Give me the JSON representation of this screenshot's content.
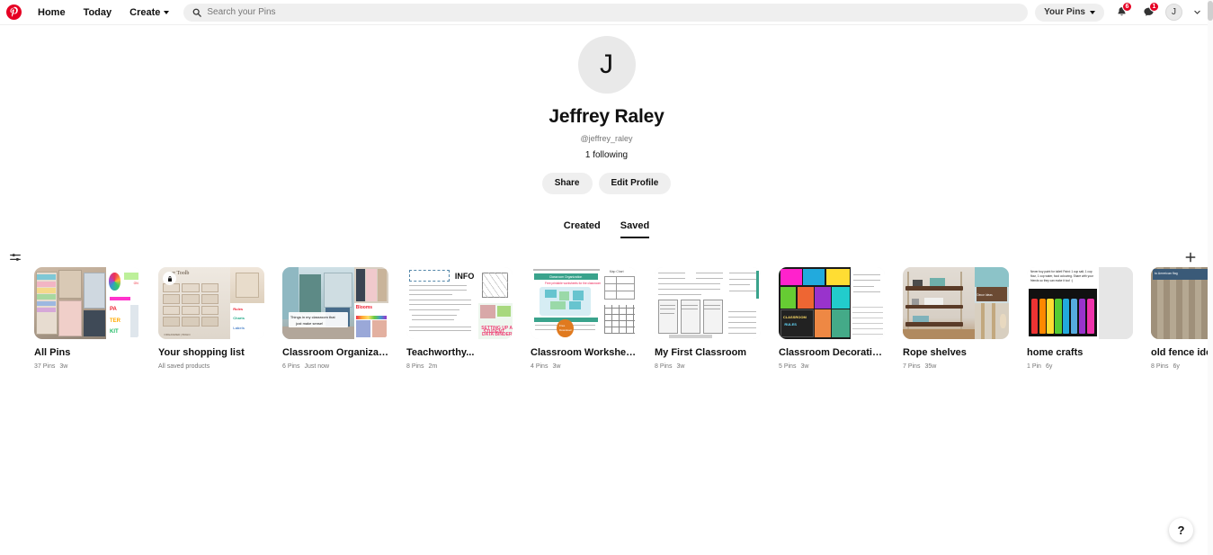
{
  "header": {
    "logo": "pinterest-logo",
    "nav": [
      {
        "label": "Home",
        "name": "nav-home"
      },
      {
        "label": "Today",
        "name": "nav-today"
      },
      {
        "label": "Create",
        "name": "nav-create"
      }
    ],
    "search": {
      "placeholder": "Search your Pins",
      "value": "",
      "icon": "search-icon"
    },
    "your_pins_label": "Your Pins",
    "notifications_badge": "6",
    "messages_badge": "1",
    "avatar_initial": "J"
  },
  "profile": {
    "avatar_initial": "J",
    "name": "Jeffrey Raley",
    "handle": "@jeffrey_raley",
    "following": "1 following",
    "share_label": "Share",
    "edit_label": "Edit Profile"
  },
  "tabs": [
    {
      "label": "Created",
      "active": false
    },
    {
      "label": "Saved",
      "active": true
    }
  ],
  "toolbar": {
    "filter_icon": "sliders-icon",
    "add_icon": "plus-icon"
  },
  "boards": [
    {
      "title": "All Pins",
      "pins": "37 Pins",
      "updated": "3w",
      "secret": false
    },
    {
      "title": "Your shopping list",
      "pins": "All saved products",
      "updated": "",
      "secret": true
    },
    {
      "title": "Classroom Organization",
      "pins": "6 Pins",
      "updated": "Just now",
      "secret": false
    },
    {
      "title": "Teachworthy...",
      "pins": "8 Pins",
      "updated": "2m",
      "secret": false
    },
    {
      "title": "Classroom Worksheets",
      "pins": "4 Pins",
      "updated": "3w",
      "secret": false
    },
    {
      "title": "My First Classroom",
      "pins": "8 Pins",
      "updated": "3w",
      "secret": false
    },
    {
      "title": "Classroom Decoration...",
      "pins": "5 Pins",
      "updated": "3w",
      "secret": false
    },
    {
      "title": "Rope shelves",
      "pins": "7 Pins",
      "updated": "35w",
      "secret": false
    },
    {
      "title": "home crafts",
      "pins": "1 Pin",
      "updated": "6y",
      "secret": false
    },
    {
      "title": "old fence ideas",
      "pins": "8 Pins",
      "updated": "6y",
      "secret": false
    }
  ],
  "help": {
    "label": "?"
  },
  "colors": {
    "brand": "#e60023",
    "badge": "#e60023",
    "pill_bg": "#efefef",
    "muted_text": "#767676"
  }
}
